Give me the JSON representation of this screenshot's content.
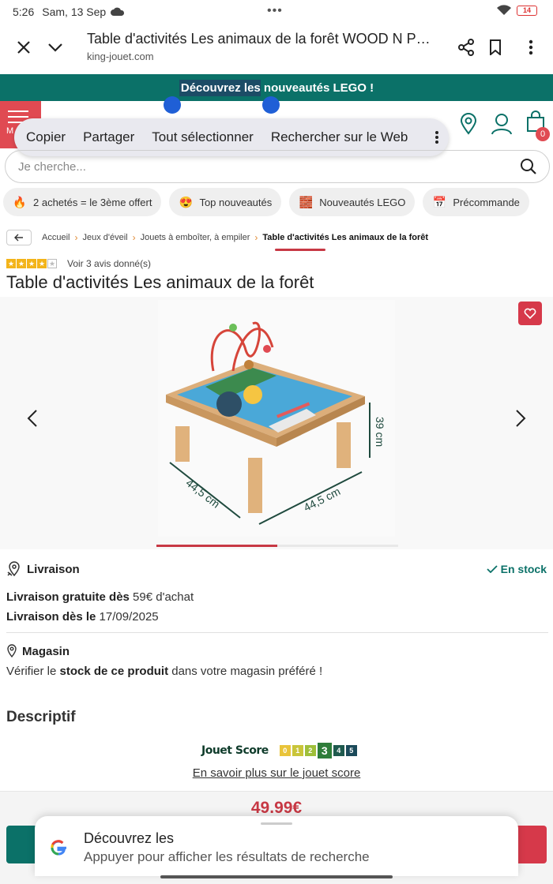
{
  "status_bar": {
    "time": "5:26",
    "date": "Sam, 13 Sep",
    "battery": "14"
  },
  "browser": {
    "page_title": "Table d'activités Les animaux de la forêt WOOD N PLA...",
    "domain": "king-jouet.com"
  },
  "promo": {
    "highlight": "Découvrez les",
    "rest": " nouveautés LEGO !"
  },
  "header": {
    "menu_label": "M",
    "cart_count": "0"
  },
  "context_menu": {
    "items": [
      "Copier",
      "Partager",
      "Tout sélectionner",
      "Rechercher sur le Web"
    ]
  },
  "search": {
    "placeholder": "Je cherche..."
  },
  "chips": [
    {
      "label": "2 achetés = le 3ème offert",
      "icon": "fire-icon",
      "glyph": "🔥"
    },
    {
      "label": "Top nouveautés",
      "icon": "heart-eyes-icon",
      "glyph": "😍"
    },
    {
      "label": "Nouveautés LEGO",
      "icon": "lego-brick-icon",
      "glyph": "🧱"
    },
    {
      "label": "Précommande",
      "icon": "calendar-icon",
      "glyph": "📅"
    }
  ],
  "breadcrumb": {
    "items": [
      "Accueil",
      "Jeux d'éveil",
      "Jouets à emboîter, à empiler"
    ],
    "current": "Table d'activités Les animaux de la forêt"
  },
  "rating": {
    "stars": 4,
    "max": 5,
    "label": "Voir 3 avis donné(s)"
  },
  "product": {
    "title": "Table d'activités Les animaux de la forêt"
  },
  "gallery": {
    "dimension_depth": "44,5 cm",
    "dimension_width": "44,5 cm",
    "dimension_height": "39 cm",
    "carousel_progress": 0.5
  },
  "delivery": {
    "label": "Livraison",
    "stock": "En stock",
    "free_label": "Livraison gratuite dès",
    "free_value": " 59€ d'achat",
    "date_label": "Livraison dès le",
    "date_value": " 17/09/2025"
  },
  "store": {
    "label": "Magasin",
    "text_before": "Vérifier le ",
    "text_bold": "stock de ce produit",
    "text_after": " dans votre magasin préféré !"
  },
  "description": {
    "title": "Descriptif"
  },
  "jouet_score": {
    "brand": "Jouet Score",
    "levels": [
      "0",
      "1",
      "2",
      "3",
      "4",
      "5"
    ],
    "active": "3",
    "colors": [
      "#e9c43a",
      "#c9c53a",
      "#9fbf3a",
      "#2f7d3a",
      "#1f5a4e",
      "#1b4a5a"
    ],
    "link": "En savoir plus sur le jouet score"
  },
  "price": "49.99€",
  "google_card": {
    "title": "Découvrez les",
    "subtitle": "Appuyer pour afficher les résultats de recherche"
  },
  "colors": {
    "teal": "#0b7168",
    "red": "#d6394a",
    "orange": "#e08a34"
  }
}
